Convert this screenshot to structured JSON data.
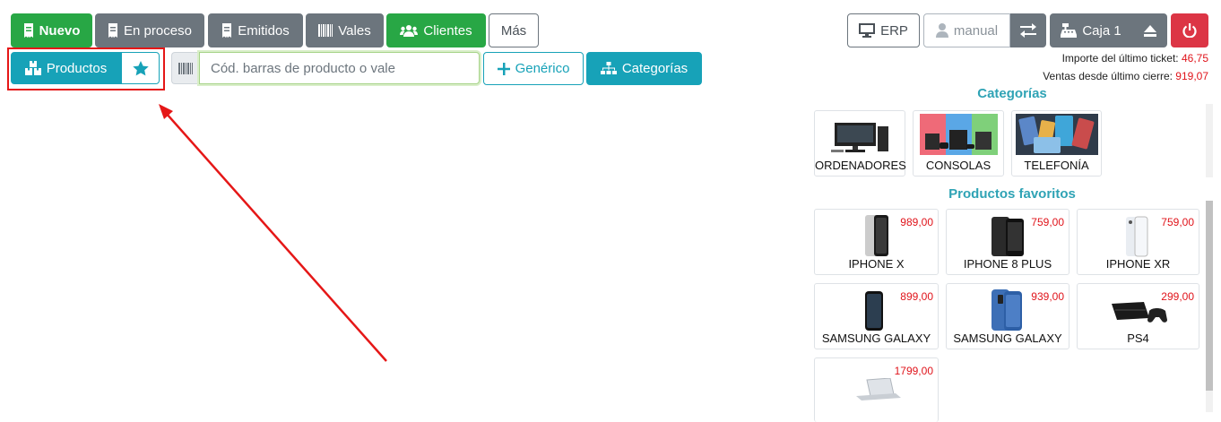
{
  "toolbar": {
    "nuevo": "Nuevo",
    "en_proceso": "En proceso",
    "emitidos": "Emitidos",
    "vales": "Vales",
    "clientes": "Clientes",
    "mas": "Más"
  },
  "toolbar2": {
    "productos": "Productos",
    "search_placeholder": "Cód. barras de producto o vale",
    "generico": "Genérico",
    "categorias": "Categorías"
  },
  "right_toolbar": {
    "erp": "ERP",
    "user": "manual",
    "caja": "Caja 1"
  },
  "info": {
    "ticket_label": "Importe del último ticket:",
    "ticket_value": "46,75",
    "ventas_label": "Ventas desde último cierre:",
    "ventas_value": "919,07"
  },
  "categories_title": "Categorías",
  "categories": [
    {
      "name": "ORDENADORES",
      "icon": "desktop-computer-image"
    },
    {
      "name": "CONSOLAS",
      "icon": "game-consoles-image"
    },
    {
      "name": "TELEFONÍA",
      "icon": "phones-image"
    }
  ],
  "favorites_title": "Productos favoritos",
  "favorites": [
    {
      "name": "IPHONE X",
      "price": "989,00",
      "icon": "iphone-x-image"
    },
    {
      "name": "IPHONE 8 PLUS",
      "price": "759,00",
      "icon": "iphone-8-plus-image"
    },
    {
      "name": "IPHONE XR",
      "price": "759,00",
      "icon": "iphone-xr-image"
    },
    {
      "name": "SAMSUNG GALAXY",
      "price": "899,00",
      "icon": "samsung-galaxy-black-image"
    },
    {
      "name": "SAMSUNG GALAXY",
      "price": "939,00",
      "icon": "samsung-galaxy-blue-image"
    },
    {
      "name": "PS4",
      "price": "299,00",
      "icon": "ps4-image"
    },
    {
      "name": "",
      "price": "1799,00",
      "icon": "laptop-image"
    }
  ],
  "colors": {
    "green": "#28a745",
    "gray": "#6c757d",
    "teal": "#17a2b8",
    "red": "#dc3545",
    "annotation_red": "#e51717",
    "price_red": "#e0141b",
    "section_title": "#2fa3b5"
  }
}
